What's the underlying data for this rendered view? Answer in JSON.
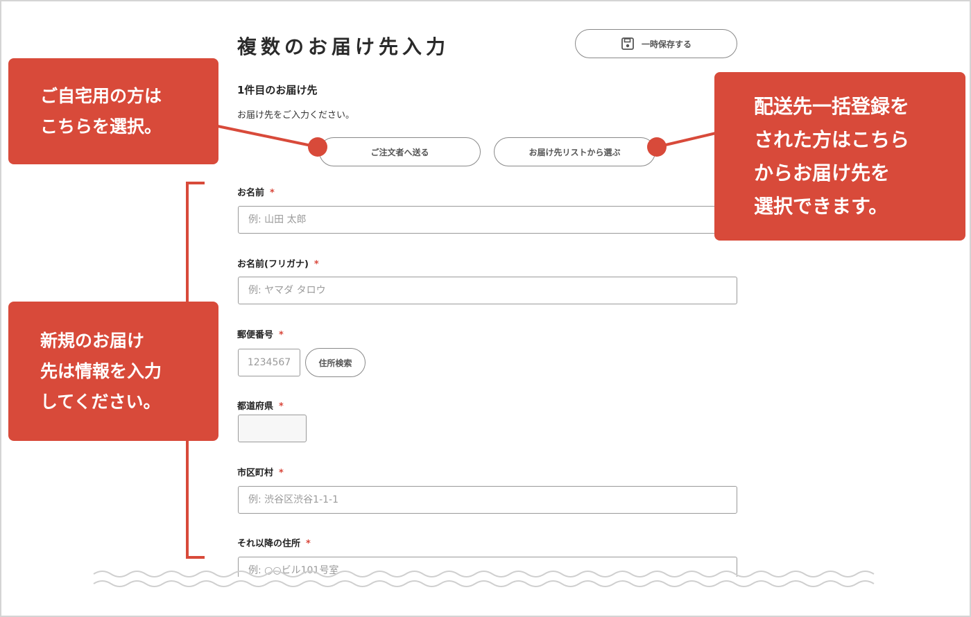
{
  "page": {
    "title": "複数のお届け先入力",
    "save_button": "一時保存する",
    "save_icon": "floppy-disk-icon"
  },
  "section": {
    "title": "1件目のお届け先",
    "description": "お届け先をご入力ください。",
    "send_to_orderer_button": "ご注文者へ送る",
    "choose_from_list_button": "お届け先リストから選ぶ"
  },
  "form": {
    "required_mark": "*",
    "name": {
      "label": "お名前",
      "placeholder": "例: 山田 太郎"
    },
    "kana": {
      "label": "お名前(フリガナ)",
      "placeholder": "例: ヤマダ タロウ"
    },
    "zip": {
      "label": "郵便番号",
      "placeholder": "1234567",
      "search_button": "住所検索"
    },
    "prefecture": {
      "label": "都道府県"
    },
    "city": {
      "label": "市区町村",
      "placeholder": "例: 渋谷区渋谷1-1-1"
    },
    "address": {
      "label": "それ以降の住所",
      "placeholder": "例: ○○ビル101号室"
    }
  },
  "callouts": {
    "home": "ご自宅用の方は\nこちらを選択。",
    "list": "配送先一括登録を\nされた方はこちら\nからお届け先を\n選択できます。",
    "new": "新規のお届け\n先は情報を入力\nしてください。"
  },
  "colors": {
    "accent": "#d84a3a",
    "required": "#d9473b",
    "border": "#999999"
  }
}
